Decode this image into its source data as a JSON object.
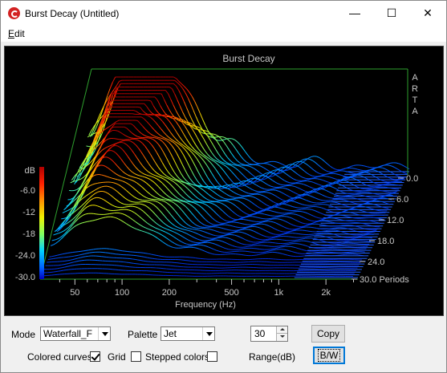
{
  "window": {
    "title": "Burst Decay  (Untitled)",
    "minimize_glyph": "—",
    "maximize_glyph": "☐",
    "close_glyph": "✕"
  },
  "menu": {
    "edit_label_first": "E",
    "edit_label_rest": "dit"
  },
  "plot": {
    "title": "Burst Decay",
    "brand": [
      "A",
      "R",
      "T",
      "A"
    ],
    "xlabel": "Frequency (Hz)",
    "x_ticks": [
      "50",
      "100",
      "200",
      "500",
      "1k",
      "2k"
    ],
    "db_unit": "dB",
    "db_ticks": [
      "-6.0",
      "-12",
      "-18",
      "-24.0",
      "-30.0"
    ],
    "period_ticks": [
      "0.0",
      "6.0",
      "12.0",
      "18.0",
      "24.0",
      "30.0 Periods"
    ],
    "colors": {
      "frame": "#2ea02e",
      "text": "#c8c8c8"
    }
  },
  "controls": {
    "mode_label": "Mode",
    "mode_value": "Waterfall_F",
    "palette_label": "Palette",
    "palette_value": "Jet",
    "range_value": "30",
    "range_label": "Range(dB)",
    "copy_label": "Copy",
    "bw_label": "B/W",
    "colored_curves_label": "Colored curves",
    "colored_curves_checked": true,
    "grid_label": "Grid",
    "grid_checked": false,
    "stepped_label": "Stepped colors",
    "stepped_checked": false
  },
  "chart_data": {
    "type": "waterfall",
    "title": "Burst Decay",
    "xlabel": "Frequency (Hz)",
    "x_scale": "log",
    "x_ticks": [
      "50",
      "100",
      "200",
      "500",
      "1k",
      "2k"
    ],
    "z_label": "dB",
    "z_ticks": [
      -6,
      -12,
      -18,
      -24,
      -30
    ],
    "z_range": [
      -30,
      0
    ],
    "depth_label": "Periods",
    "depth_ticks": [
      0,
      6,
      12,
      18,
      24,
      30
    ],
    "palette": "Jet"
  }
}
